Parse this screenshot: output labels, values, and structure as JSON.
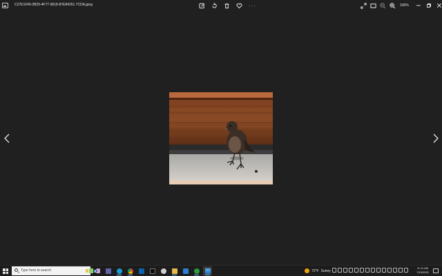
{
  "window": {
    "filename": "C27E1040-3B25-4F77-9618-87E84251 7CDA.jpeg",
    "zoom": "100%"
  },
  "toolbar": {
    "center_icons": [
      "edit-image-icon",
      "rotate-icon",
      "delete-icon",
      "favorite-icon",
      "more-icon"
    ],
    "right_icons": [
      "fullscreen-icon",
      "fit-window-icon",
      "zoom-out-icon",
      "zoom-in-icon"
    ]
  },
  "viewer": {
    "prev_icon": "chevron-left-icon",
    "next_icon": "chevron-right-icon"
  },
  "taskbar": {
    "search_placeholder": "Type here to search",
    "weather_temp": "72°F",
    "weather_condition": "Sunny",
    "time": "11:11 AM",
    "date": "7/15/2022",
    "apps": [
      "task-view-icon",
      "chat-icon",
      "edge-icon",
      "chrome-icon",
      "mail-icon",
      "terminal-icon",
      "people-icon",
      "explorer-icon",
      "store-icon",
      "xbox-icon",
      "photos-icon"
    ]
  },
  "colors": {
    "background": "#202020",
    "taskbar": "#1c1c1c",
    "accent": "#7fb6e6"
  }
}
